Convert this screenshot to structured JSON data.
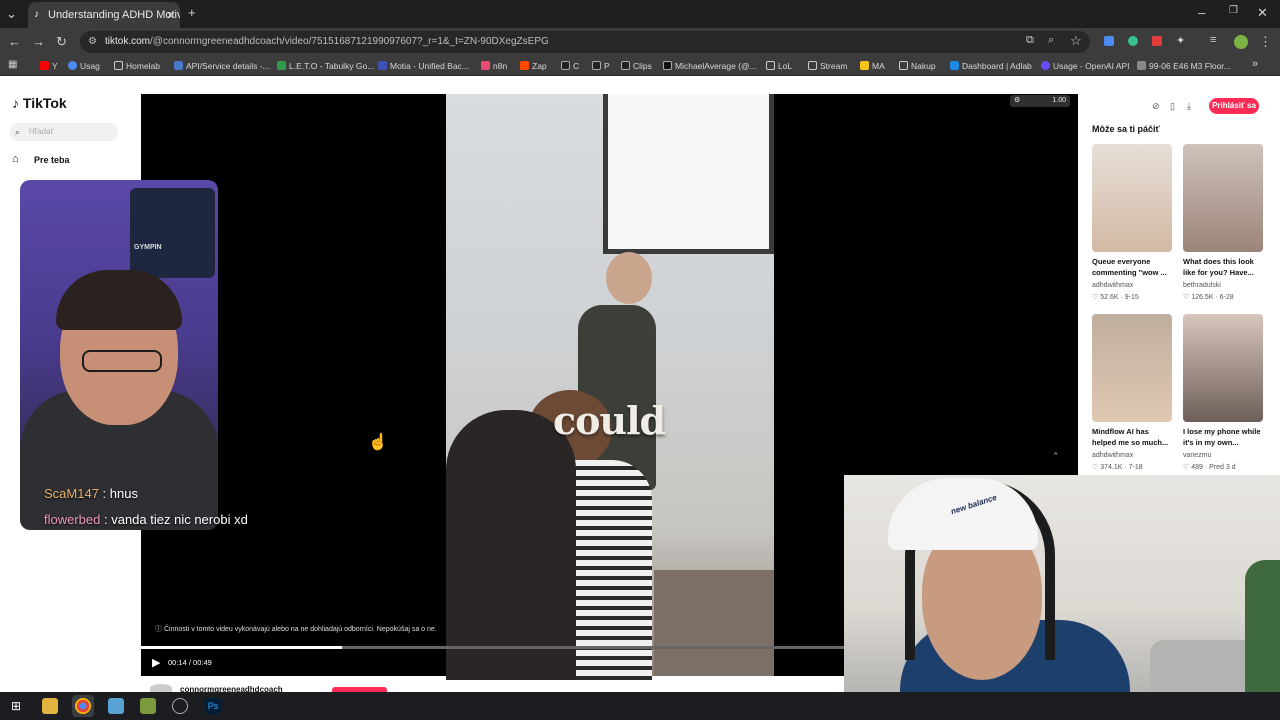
{
  "browser": {
    "tab_title": "Understanding ADHD Motivati",
    "url_host": "tiktok.com",
    "url_path": "/@connormgreeneadhdcoach/video/7515168712199097607?_r=1&_t=ZN-90DXegZsEPG",
    "zoom_label": "1.00",
    "bookmarks": [
      "Y",
      "Usag",
      "Homelab",
      "API/Service details -...",
      "L.E.T.O - Tabulky Go...",
      "Motia - Unified Bac...",
      "n8n",
      "Zap",
      "C",
      "P",
      "Clips",
      "MichaelAverage (@...",
      "LoL",
      "Stream",
      "MA",
      "Nakup",
      "Dashboard | Adlab",
      "Usage - OpenAI API",
      "99-06 E46 M3 Floor..."
    ]
  },
  "tiktok": {
    "logo": "TikTok",
    "search_placeholder": "Hľadať",
    "nav_for_you": "Pre teba",
    "login_button": "Prihlásiť sa",
    "recommended_title": "Môže sa ti páčiť",
    "video": {
      "caption_word": "could",
      "disclaimer": "Činnosti v tomto videu vykonávajú alebo na ne dohliadajú odborníci. Nepokúšaj sa o ne.",
      "time": "00:14 / 00:49",
      "progress": 0.2857,
      "author_partial": "connormgreeneadhdcoach"
    },
    "recommended": [
      {
        "title": "Queue everyone commenting \"wow ...",
        "user": "adhdwithmax",
        "stats": "52.6K · 9-15",
        "color": "#d8c2ad"
      },
      {
        "title": "What does this look like for you? Have...",
        "user": "bethradulski",
        "stats": "126.5K · 6-28",
        "color": "#b8a59a"
      },
      {
        "title": "Mindflow AI has helped me so much...",
        "user": "adhdwithmax",
        "stats": "374.1K · 7-18",
        "color": "#cfb39b"
      },
      {
        "title": "I lose my phone while it's in my own...",
        "user": "vanezmu",
        "stats": "489 · Pred 3 d",
        "color": "#a28b80"
      }
    ]
  },
  "overlay": {
    "shelf_label": "GYMPIN",
    "chat": [
      {
        "user": "ScaM147",
        "message": "hnus"
      },
      {
        "user": "flowerbed",
        "message": "vanda tiez nic nerobi xd"
      }
    ],
    "cap_text": "new balance"
  }
}
